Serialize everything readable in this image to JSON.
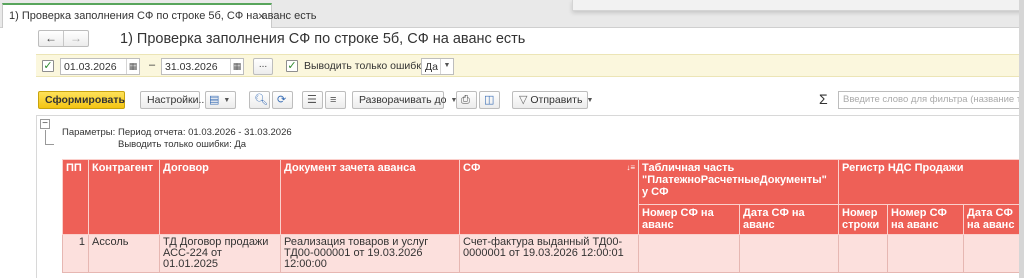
{
  "tab": {
    "label": "1) Проверка заполнения СФ по строке 5б, СФ на аванс есть",
    "close": "×"
  },
  "nav": {
    "back": "←",
    "forward": "→"
  },
  "title": "1) Проверка заполнения СФ по строке 5б, СФ на аванс есть",
  "params": {
    "date_from": "01.03.2026",
    "dash": "–",
    "date_to": "31.03.2026",
    "more_button": "...",
    "only_errors_label": "Выводить только ошибки:",
    "only_errors_value": "Да",
    "checkmark": "✓"
  },
  "toolbar": {
    "generate": "Сформировать",
    "settings": "Настройки...",
    "expand": "Разворачивать до",
    "send": "Отправить",
    "sigma": "Σ",
    "search_placeholder": "Введите слово для фильтра (название товара)"
  },
  "report": {
    "params_label": "Параметры:",
    "period_text": "Период отчета: 01.03.2026 - 31.03.2026",
    "only_errors_text": "Выводить только ошибки: Да",
    "header1": [
      "ПП",
      "Контрагент",
      "Договор",
      "Документ зачета аванса",
      "СФ",
      "Табличная часть \"ПлатежноРасчетныеДокументы\" у СФ",
      "Регистр НДС Продажи"
    ],
    "header2": [
      "Номер СФ на аванс",
      "Дата СФ на аванс",
      "Номер строки",
      "Номер СФ на аванс",
      "Дата СФ на аванс"
    ],
    "rows": [
      {
        "pp": "1",
        "counterparty": "Ассоль",
        "contract": "ТД Договор продажи АСС-224 от 01.01.2025",
        "advance_doc": "Реализация товаров и услуг ТД00-000001 от 19.03.2026 12:00:00",
        "invoice": "Счет-фактура выданный ТД00-0000001 от 19.03.2026 12:00:01"
      }
    ]
  },
  "colors": {
    "header_bg": "#ee6057",
    "row_bg": "#fce0dd",
    "param_bg": "#fbf7dd",
    "primary_btn": "#f3c413",
    "tab_accent": "#58a55c"
  }
}
